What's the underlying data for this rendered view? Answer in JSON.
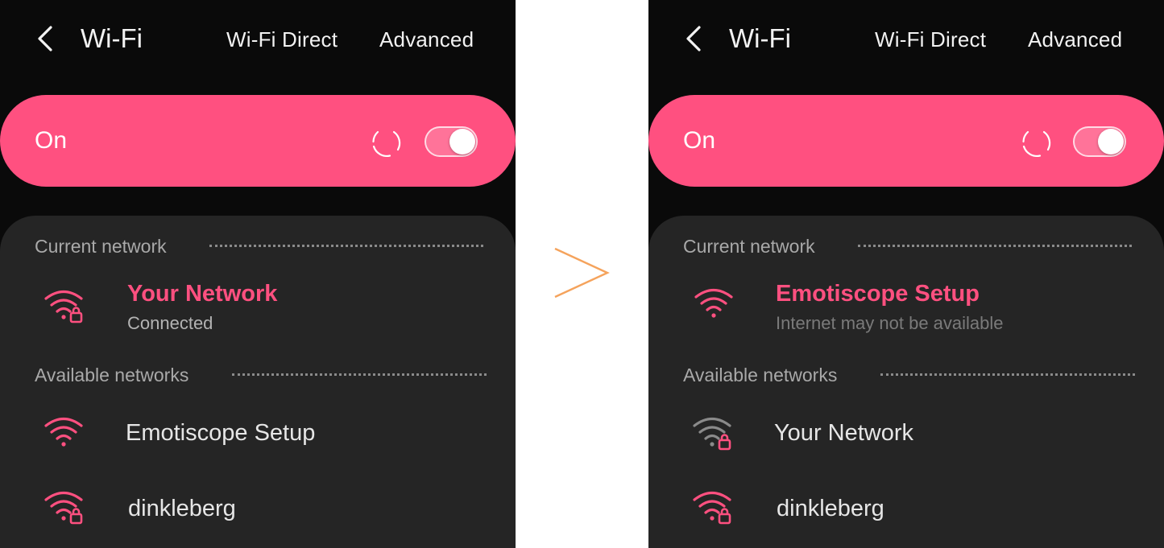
{
  "colors": {
    "accent": "#ff5080",
    "panel_bg": "#0a0a0a",
    "card_bg": "#252525",
    "arrow": "#f5a35c",
    "icon_gray": "#8a8a8a"
  },
  "left": {
    "header": {
      "back_icon": "chevron-left-icon",
      "title": "Wi-Fi",
      "wifi_direct": "Wi-Fi Direct",
      "advanced": "Advanced"
    },
    "toggle": {
      "label": "On",
      "state": true,
      "scanning": true
    },
    "current_section": "Current network",
    "current": {
      "name": "Your Network",
      "status": "Connected",
      "secured": true
    },
    "available_section": "Available networks",
    "available": [
      {
        "name": "Emotiscope Setup",
        "secured": false,
        "icon_color": "accent"
      },
      {
        "name": "dinkleberg",
        "secured": true,
        "icon_color": "accent"
      }
    ]
  },
  "arrow_icon": "chevron-right-icon",
  "right": {
    "header": {
      "back_icon": "chevron-left-icon",
      "title": "Wi-Fi",
      "wifi_direct": "Wi-Fi Direct",
      "advanced": "Advanced"
    },
    "toggle": {
      "label": "On",
      "state": true,
      "scanning": true
    },
    "current_section": "Current network",
    "current": {
      "name": "Emotiscope Setup",
      "status": "Internet may not be available",
      "secured": false
    },
    "available_section": "Available networks",
    "available": [
      {
        "name": "Your Network",
        "secured": true,
        "icon_color": "gray"
      },
      {
        "name": "dinkleberg",
        "secured": true,
        "icon_color": "accent"
      }
    ]
  }
}
